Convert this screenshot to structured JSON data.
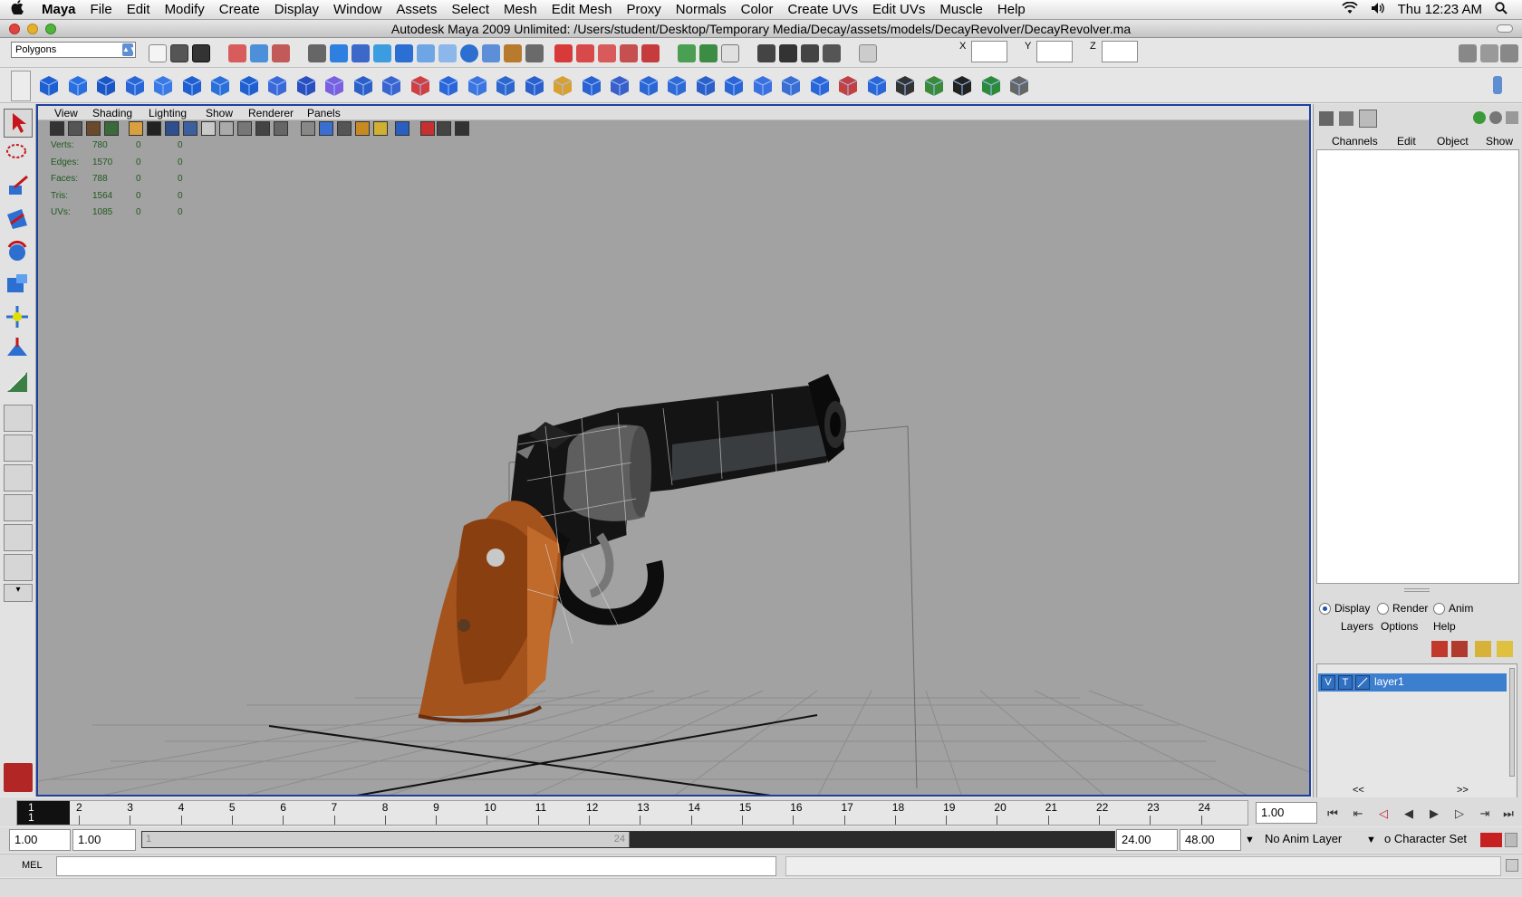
{
  "mac_menubar": {
    "apple": "",
    "items": [
      "Maya",
      "File",
      "Edit",
      "Modify",
      "Create",
      "Display",
      "Window",
      "Assets",
      "Select",
      "Mesh",
      "Edit Mesh",
      "Proxy",
      "Normals",
      "Color",
      "Create UVs",
      "Edit UVs",
      "Muscle",
      "Help"
    ],
    "clock": "Thu 12:23 AM"
  },
  "window": {
    "title": "Autodesk Maya 2009 Unlimited: /Users/student/Desktop/Temporary Media/Decay/assets/models/DecayRevolver/DecayRevolver.ma"
  },
  "status_line": {
    "mode": "Polygons",
    "x_label": "X",
    "y_label": "Y",
    "z_label": "Z"
  },
  "viewport": {
    "menus": [
      "View",
      "Shading",
      "Lighting",
      "Show",
      "Renderer",
      "Panels"
    ],
    "hud": [
      {
        "label": "Verts:",
        "v1": "780",
        "v2": "0",
        "v3": "0"
      },
      {
        "label": "Edges:",
        "v1": "1570",
        "v2": "0",
        "v3": "0"
      },
      {
        "label": "Faces:",
        "v1": "788",
        "v2": "0",
        "v3": "0"
      },
      {
        "label": "Tris:",
        "v1": "1564",
        "v2": "0",
        "v3": "0"
      },
      {
        "label": "UVs:",
        "v1": "1085",
        "v2": "0",
        "v3": "0"
      }
    ]
  },
  "channel_box": {
    "menus": [
      "Channels",
      "Edit",
      "Object",
      "Show"
    ]
  },
  "layer_editor": {
    "modes": [
      {
        "label": "Display",
        "selected": true
      },
      {
        "label": "Render",
        "selected": false
      },
      {
        "label": "Anim",
        "selected": false
      }
    ],
    "menus": [
      "Layers",
      "Options",
      "Help"
    ],
    "layer": {
      "v": "V",
      "t": "T",
      "name": "layer1"
    },
    "nav_left": "<<",
    "nav_right": ">>"
  },
  "timeline": {
    "current_frame_top": "1",
    "current_frame_bottom": "1",
    "ticks": [
      "2",
      "3",
      "4",
      "5",
      "6",
      "7",
      "8",
      "9",
      "10",
      "11",
      "12",
      "13",
      "14",
      "15",
      "16",
      "17",
      "18",
      "19",
      "20",
      "21",
      "22",
      "23",
      "24"
    ],
    "current_time": "1.00"
  },
  "range": {
    "start_time": "1.00",
    "playback_start": "1.00",
    "slider_start": "1",
    "slider_end": "24",
    "playback_end": "24.00",
    "end_time": "48.00",
    "anim_layer": "No Anim Layer",
    "character_set": "o Character Set"
  },
  "command_line": {
    "label": "MEL"
  },
  "colors": {
    "viewport_bg": "#a2a2a2",
    "active_border": "#1f3fa0",
    "layer_selected": "#3d7fcf",
    "shelf_blue": "#1f5fd0",
    "hud_text": "#1f5a1f"
  }
}
